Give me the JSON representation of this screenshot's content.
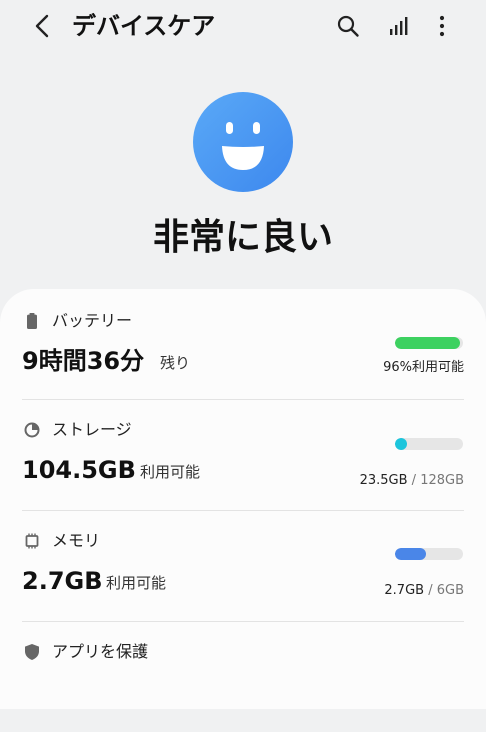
{
  "header": {
    "title": "デバイスケア",
    "back_icon": "chevron-left-icon",
    "search_icon": "search-icon",
    "stats_icon": "bar-chart-icon",
    "more_icon": "more-vertical-icon"
  },
  "status": {
    "icon": "smiley-face-icon",
    "text": "非常に良い",
    "color": "#4b9af3"
  },
  "battery": {
    "label": "バッテリー",
    "time_value": "9時間36分",
    "time_unit": "残り",
    "percent_text": "96%利用可能",
    "level": 0.96,
    "color": "#3dd160"
  },
  "storage": {
    "label": "ストレージ",
    "available_value": "104.5GB",
    "available_unit": "利用可能",
    "used": "23.5GB",
    "separator": " / ",
    "total": "128GB",
    "level": 0.18,
    "color": "#1cc5dc"
  },
  "memory": {
    "label": "メモリ",
    "available_value": "2.7GB",
    "available_unit": "利用可能",
    "used": "2.7GB",
    "separator": " / ",
    "total": "6GB",
    "level": 0.45,
    "color": "#4a86e8"
  },
  "app_protection": {
    "label": "アプリを保護"
  }
}
